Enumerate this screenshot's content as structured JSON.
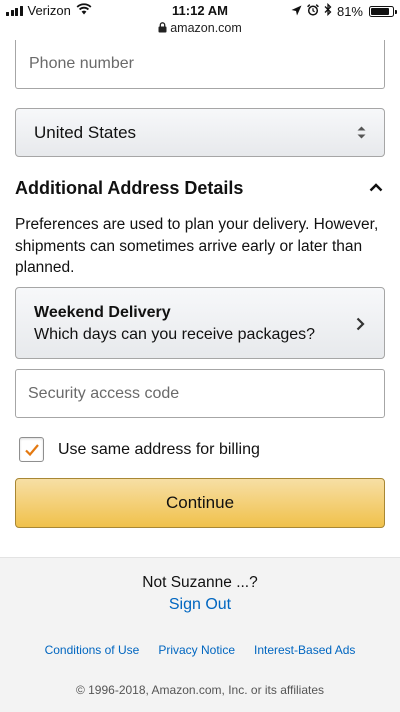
{
  "status_bar": {
    "carrier": "Verizon",
    "time": "11:12 AM",
    "url": "amazon.com",
    "battery": "81%"
  },
  "form": {
    "phone_placeholder": "Phone number",
    "country_value": "United States",
    "section_title": "Additional Address Details",
    "preferences_text": "Preferences are used to plan your delivery. However, shipments can sometimes arrive early or later than planned.",
    "weekend_title": "Weekend Delivery",
    "weekend_subtitle": "Which days can you receive packages?",
    "security_placeholder": "Security access code",
    "billing_label": "Use same address for billing",
    "billing_checked": true,
    "continue_label": "Continue"
  },
  "footer": {
    "not_user": "Not Suzanne ...?",
    "sign_out": "Sign Out",
    "links": [
      "Conditions of Use",
      "Privacy Notice",
      "Interest-Based Ads"
    ],
    "copyright": "© 1996-2018, Amazon.com, Inc. or its affiliates"
  },
  "colors": {
    "link": "#0066c0",
    "button_primary": "#f0c14b",
    "checkmark": "#e47911"
  }
}
